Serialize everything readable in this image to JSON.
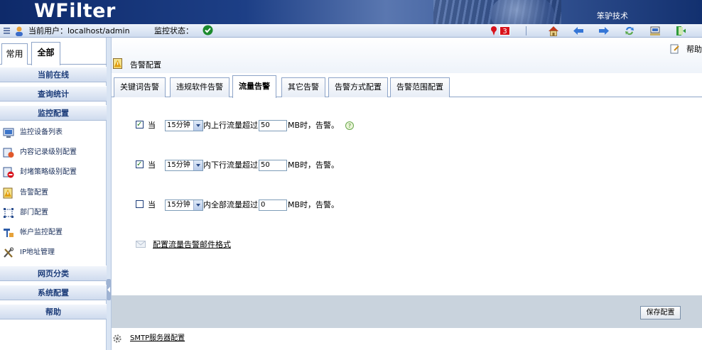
{
  "header": {
    "logo": "WFilter",
    "brand": "笨驴技术"
  },
  "toolbar": {
    "user_label": "当前用户：localhost/admin",
    "status_label": "监控状态：",
    "alert_count": "3"
  },
  "sidebar": {
    "tabs": [
      "常用",
      "全部"
    ],
    "sections": {
      "online": "当前在线",
      "stats": "查询统计",
      "monitor": "监控配置",
      "web": "网页分类",
      "system": "系统配置",
      "help": "帮助"
    },
    "items": [
      "监控设备列表",
      "内容记录级别配置",
      "封堵策略级别配置",
      "告警配置",
      "部门配置",
      "帐户监控配置",
      "IP地址管理"
    ]
  },
  "main": {
    "title": "告警配置",
    "help": "帮助",
    "tabs": [
      "关键词告警",
      "违规软件告警",
      "流量告警",
      "其它告警",
      "告警方式配置",
      "告警范围配置"
    ],
    "rules": [
      {
        "checked": true,
        "prefix": "当",
        "period": "15分钟",
        "text": "内上行流量超过",
        "value": "50",
        "suffix": "MB时，告警。"
      },
      {
        "checked": true,
        "prefix": "当",
        "period": "15分钟",
        "text": "内下行流量超过",
        "value": "50",
        "suffix": "MB时，告警。"
      },
      {
        "checked": false,
        "prefix": "当",
        "period": "15分钟",
        "text": "内全部流量超过",
        "value": "0",
        "suffix": "MB时，告警。"
      }
    ],
    "mail_format_link": "配置流量告警邮件格式",
    "save_button": "保存配置",
    "smtp_link": "SMTP服务器配置"
  }
}
